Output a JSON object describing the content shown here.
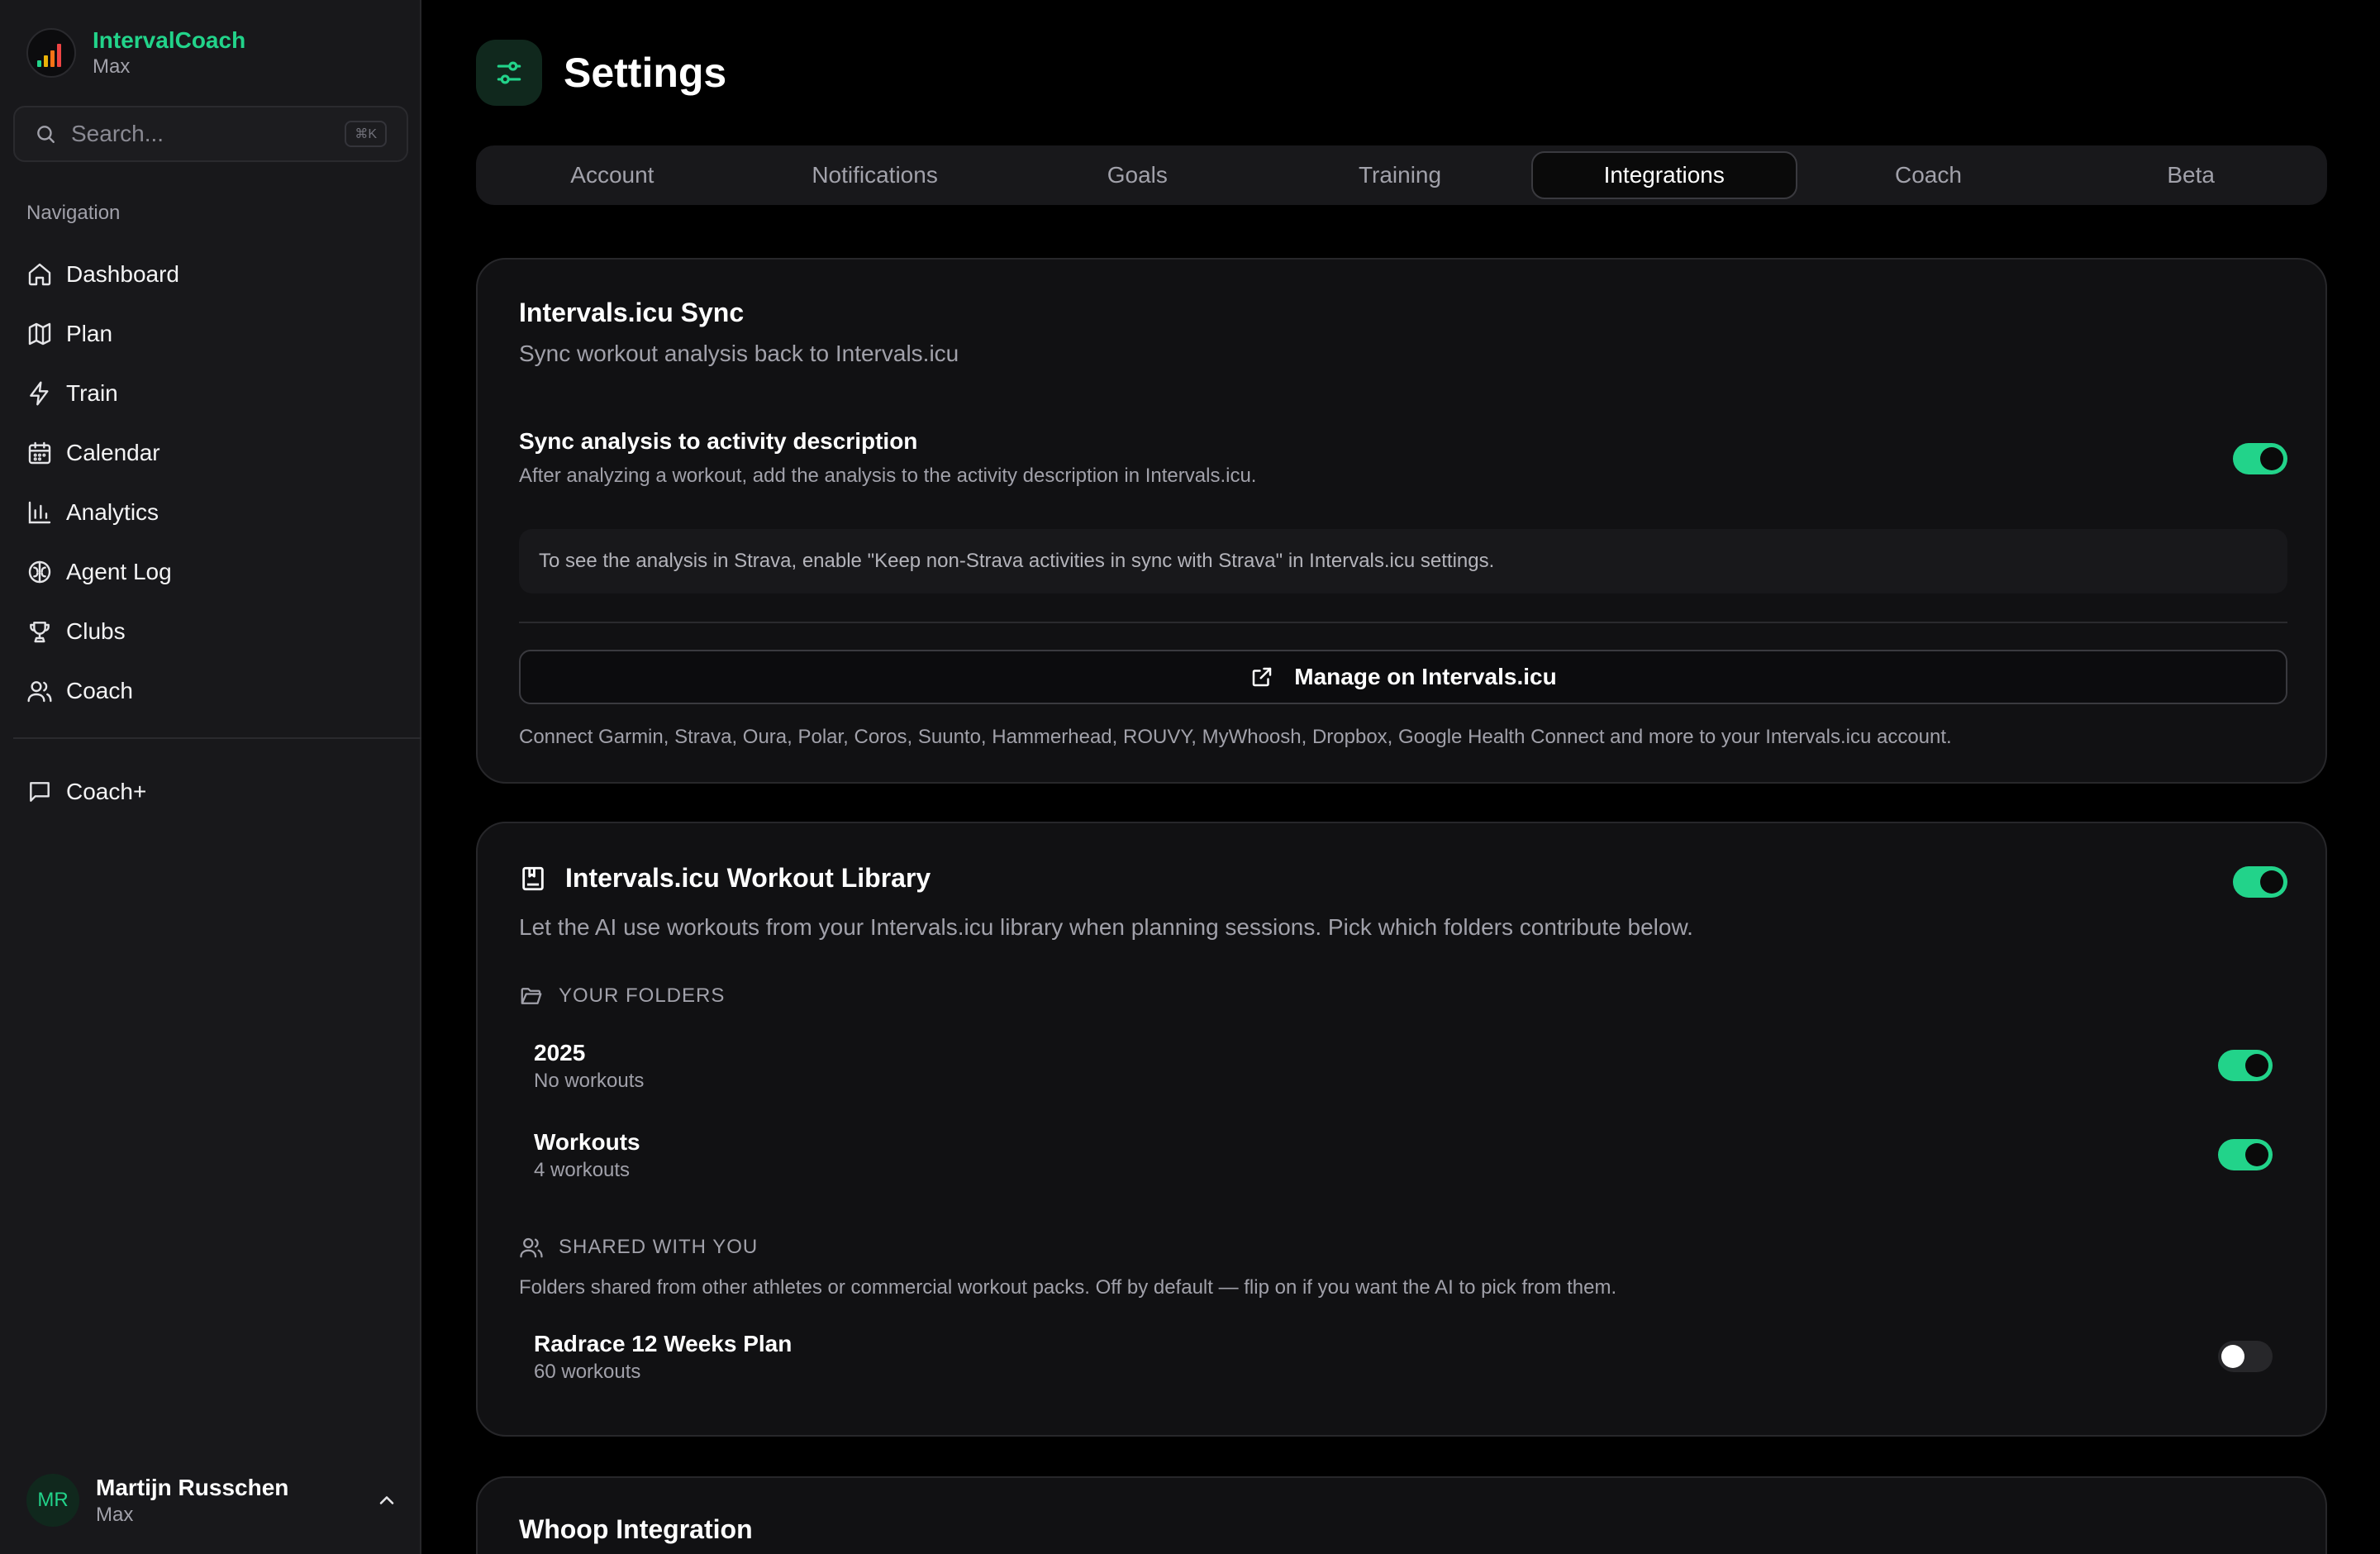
{
  "app": {
    "name": "IntervalCoach",
    "subtitle": "Max"
  },
  "search": {
    "placeholder": "Search...",
    "shortcut": "⌘K"
  },
  "sidebar": {
    "section_title": "Navigation",
    "items": [
      {
        "label": "Dashboard",
        "icon": "home-icon"
      },
      {
        "label": "Plan",
        "icon": "map-icon"
      },
      {
        "label": "Train",
        "icon": "bolt-icon"
      },
      {
        "label": "Calendar",
        "icon": "calendar-icon"
      },
      {
        "label": "Analytics",
        "icon": "bar-chart-icon"
      },
      {
        "label": "Agent Log",
        "icon": "brain-icon"
      },
      {
        "label": "Clubs",
        "icon": "trophy-icon"
      },
      {
        "label": "Coach",
        "icon": "users-icon"
      }
    ],
    "extra_item": {
      "label": "Coach+",
      "icon": "message-icon"
    }
  },
  "user": {
    "initials": "MR",
    "name": "Martijn Russchen",
    "subtitle": "Max"
  },
  "page": {
    "title": "Settings"
  },
  "tabs": [
    {
      "label": "Account",
      "active": false
    },
    {
      "label": "Notifications",
      "active": false
    },
    {
      "label": "Goals",
      "active": false
    },
    {
      "label": "Training",
      "active": false
    },
    {
      "label": "Integrations",
      "active": true
    },
    {
      "label": "Coach",
      "active": false
    },
    {
      "label": "Beta",
      "active": false
    }
  ],
  "sync_card": {
    "title": "Intervals.icu Sync",
    "description": "Sync workout analysis back to Intervals.icu",
    "setting_title": "Sync analysis to activity description",
    "setting_desc": "After analyzing a workout, add the analysis to the activity description in Intervals.icu.",
    "setting_enabled": true,
    "note": "To see the analysis in Strava, enable \"Keep non-Strava activities in sync with Strava\" in Intervals.icu settings.",
    "manage_button": "Manage on Intervals.icu",
    "connect_note": "Connect Garmin, Strava, Oura, Polar, Coros, Suunto, Hammerhead, ROUVY, MyWhoosh, Dropbox, Google Health Connect and more to your Intervals.icu account."
  },
  "library_card": {
    "title": "Intervals.icu Workout Library",
    "enabled": true,
    "description": "Let the AI use workouts from your Intervals.icu library when planning sessions. Pick which folders contribute below.",
    "your_folders_label": "YOUR FOLDERS",
    "folders": [
      {
        "name": "2025",
        "count": "No workouts",
        "enabled": true
      },
      {
        "name": "Workouts",
        "count": "4 workouts",
        "enabled": true
      }
    ],
    "shared_label": "SHARED WITH YOU",
    "shared_desc": "Folders shared from other athletes or commercial workout packs. Off by default — flip on if you want the AI to pick from them.",
    "shared_folders": [
      {
        "name": "Radrace 12 Weeks Plan",
        "count": "60 workouts",
        "enabled": false
      }
    ]
  },
  "whoop_card": {
    "title": "Whoop Integration"
  },
  "colors": {
    "accent": "#22d38a",
    "background": "#000000",
    "sidebar": "#18181b",
    "card": "#111113"
  }
}
